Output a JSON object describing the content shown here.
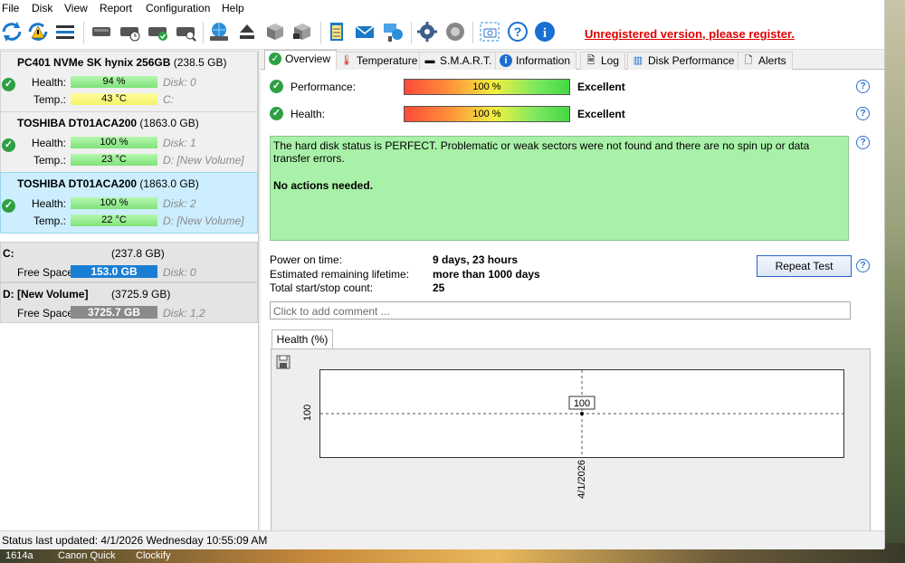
{
  "menu": [
    "File",
    "Disk",
    "View",
    "Report",
    "Configuration",
    "Help"
  ],
  "toolbar": {
    "icons": [
      "refresh-icon",
      "refresh-warning-icon",
      "list-icon",
      "disk-icon",
      "disk-clock-icon",
      "disk-check-icon",
      "disk-search-icon",
      "globe-disk-icon",
      "eject-icon",
      "cube-icon",
      "cube-lock-icon",
      "notepad-icon",
      "mail-icon",
      "network-icon",
      "gear-icon",
      "speaker-icon",
      "camera-icon",
      "help-icon",
      "info-icon"
    ],
    "unregistered": "Unregistered version, please register."
  },
  "disks": [
    {
      "name": "PC401 NVMe SK hynix 256GB",
      "size": "(238.5 GB)",
      "health_label": "Health:",
      "health": "94 %",
      "health_pct": 94,
      "disk_idx": "Disk: 0",
      "temp_label": "Temp.:",
      "temp": "43 °C",
      "temp_color": "yellow",
      "drive": "C:"
    },
    {
      "name": "TOSHIBA DT01ACA200",
      "size": "(1863.0 GB)",
      "health_label": "Health:",
      "health": "100 %",
      "health_pct": 100,
      "disk_idx": "Disk: 1",
      "temp_label": "Temp.:",
      "temp": "23 °C",
      "temp_color": "green",
      "drive": "D: [New Volume]"
    },
    {
      "name": "TOSHIBA DT01ACA200",
      "size": "(1863.0 GB)",
      "health_label": "Health:",
      "health": "100 %",
      "health_pct": 100,
      "disk_idx": "Disk: 2",
      "temp_label": "Temp.:",
      "temp": "22 °C",
      "temp_color": "green",
      "drive": "D: [New Volume]"
    }
  ],
  "volumes": [
    {
      "name": "C:",
      "size": "(237.8 GB)",
      "free_label": "Free Space",
      "free": "153.0 GB",
      "free_color": "#1a7fd4",
      "disks": "Disk: 0"
    },
    {
      "name": "D: [New Volume]",
      "size": "(3725.9 GB)",
      "free_label": "Free Space",
      "free": "3725.7 GB",
      "free_color": "#8a8a8a",
      "disks": "Disk: 1,2"
    }
  ],
  "tabs": [
    {
      "label": "Overview",
      "icon": "check-icon"
    },
    {
      "label": "Temperature",
      "icon": "thermometer-icon"
    },
    {
      "label": "S.M.A.R.T.",
      "icon": "dash-icon"
    },
    {
      "label": "Information",
      "icon": "info-icon"
    },
    {
      "label": "Log",
      "icon": "document-icon"
    },
    {
      "label": "Disk Performance",
      "icon": "chart-icon"
    },
    {
      "label": "Alerts",
      "icon": "alert-icon"
    }
  ],
  "overview": {
    "performance_label": "Performance:",
    "performance_value": "100 %",
    "performance_rating": "Excellent",
    "health_label": "Health:",
    "health_value": "100 %",
    "health_rating": "Excellent",
    "status_text": "The hard disk status is PERFECT. Problematic or weak sectors were not found and there are no spin up or data transfer errors.",
    "action_text": "No actions needed.",
    "power_on_label": "Power on time:",
    "power_on_value": "9 days, 23 hours",
    "lifetime_label": "Estimated remaining lifetime:",
    "lifetime_value": "more than 1000 days",
    "startstop_label": "Total start/stop count:",
    "startstop_value": "25",
    "repeat_button": "Repeat Test",
    "comment_placeholder": "Click to add comment ..."
  },
  "chart_tab": "Health (%)",
  "chart_data": {
    "type": "scatter",
    "x": [
      "4/1/2026"
    ],
    "y": [
      100
    ],
    "ylabel": "100",
    "data_label": "100"
  },
  "statusbar": "Status last updated: 4/1/2026 Wednesday 10:55:09 AM",
  "taskbar": [
    "1614a",
    "Canon Quick",
    "Clockify"
  ]
}
